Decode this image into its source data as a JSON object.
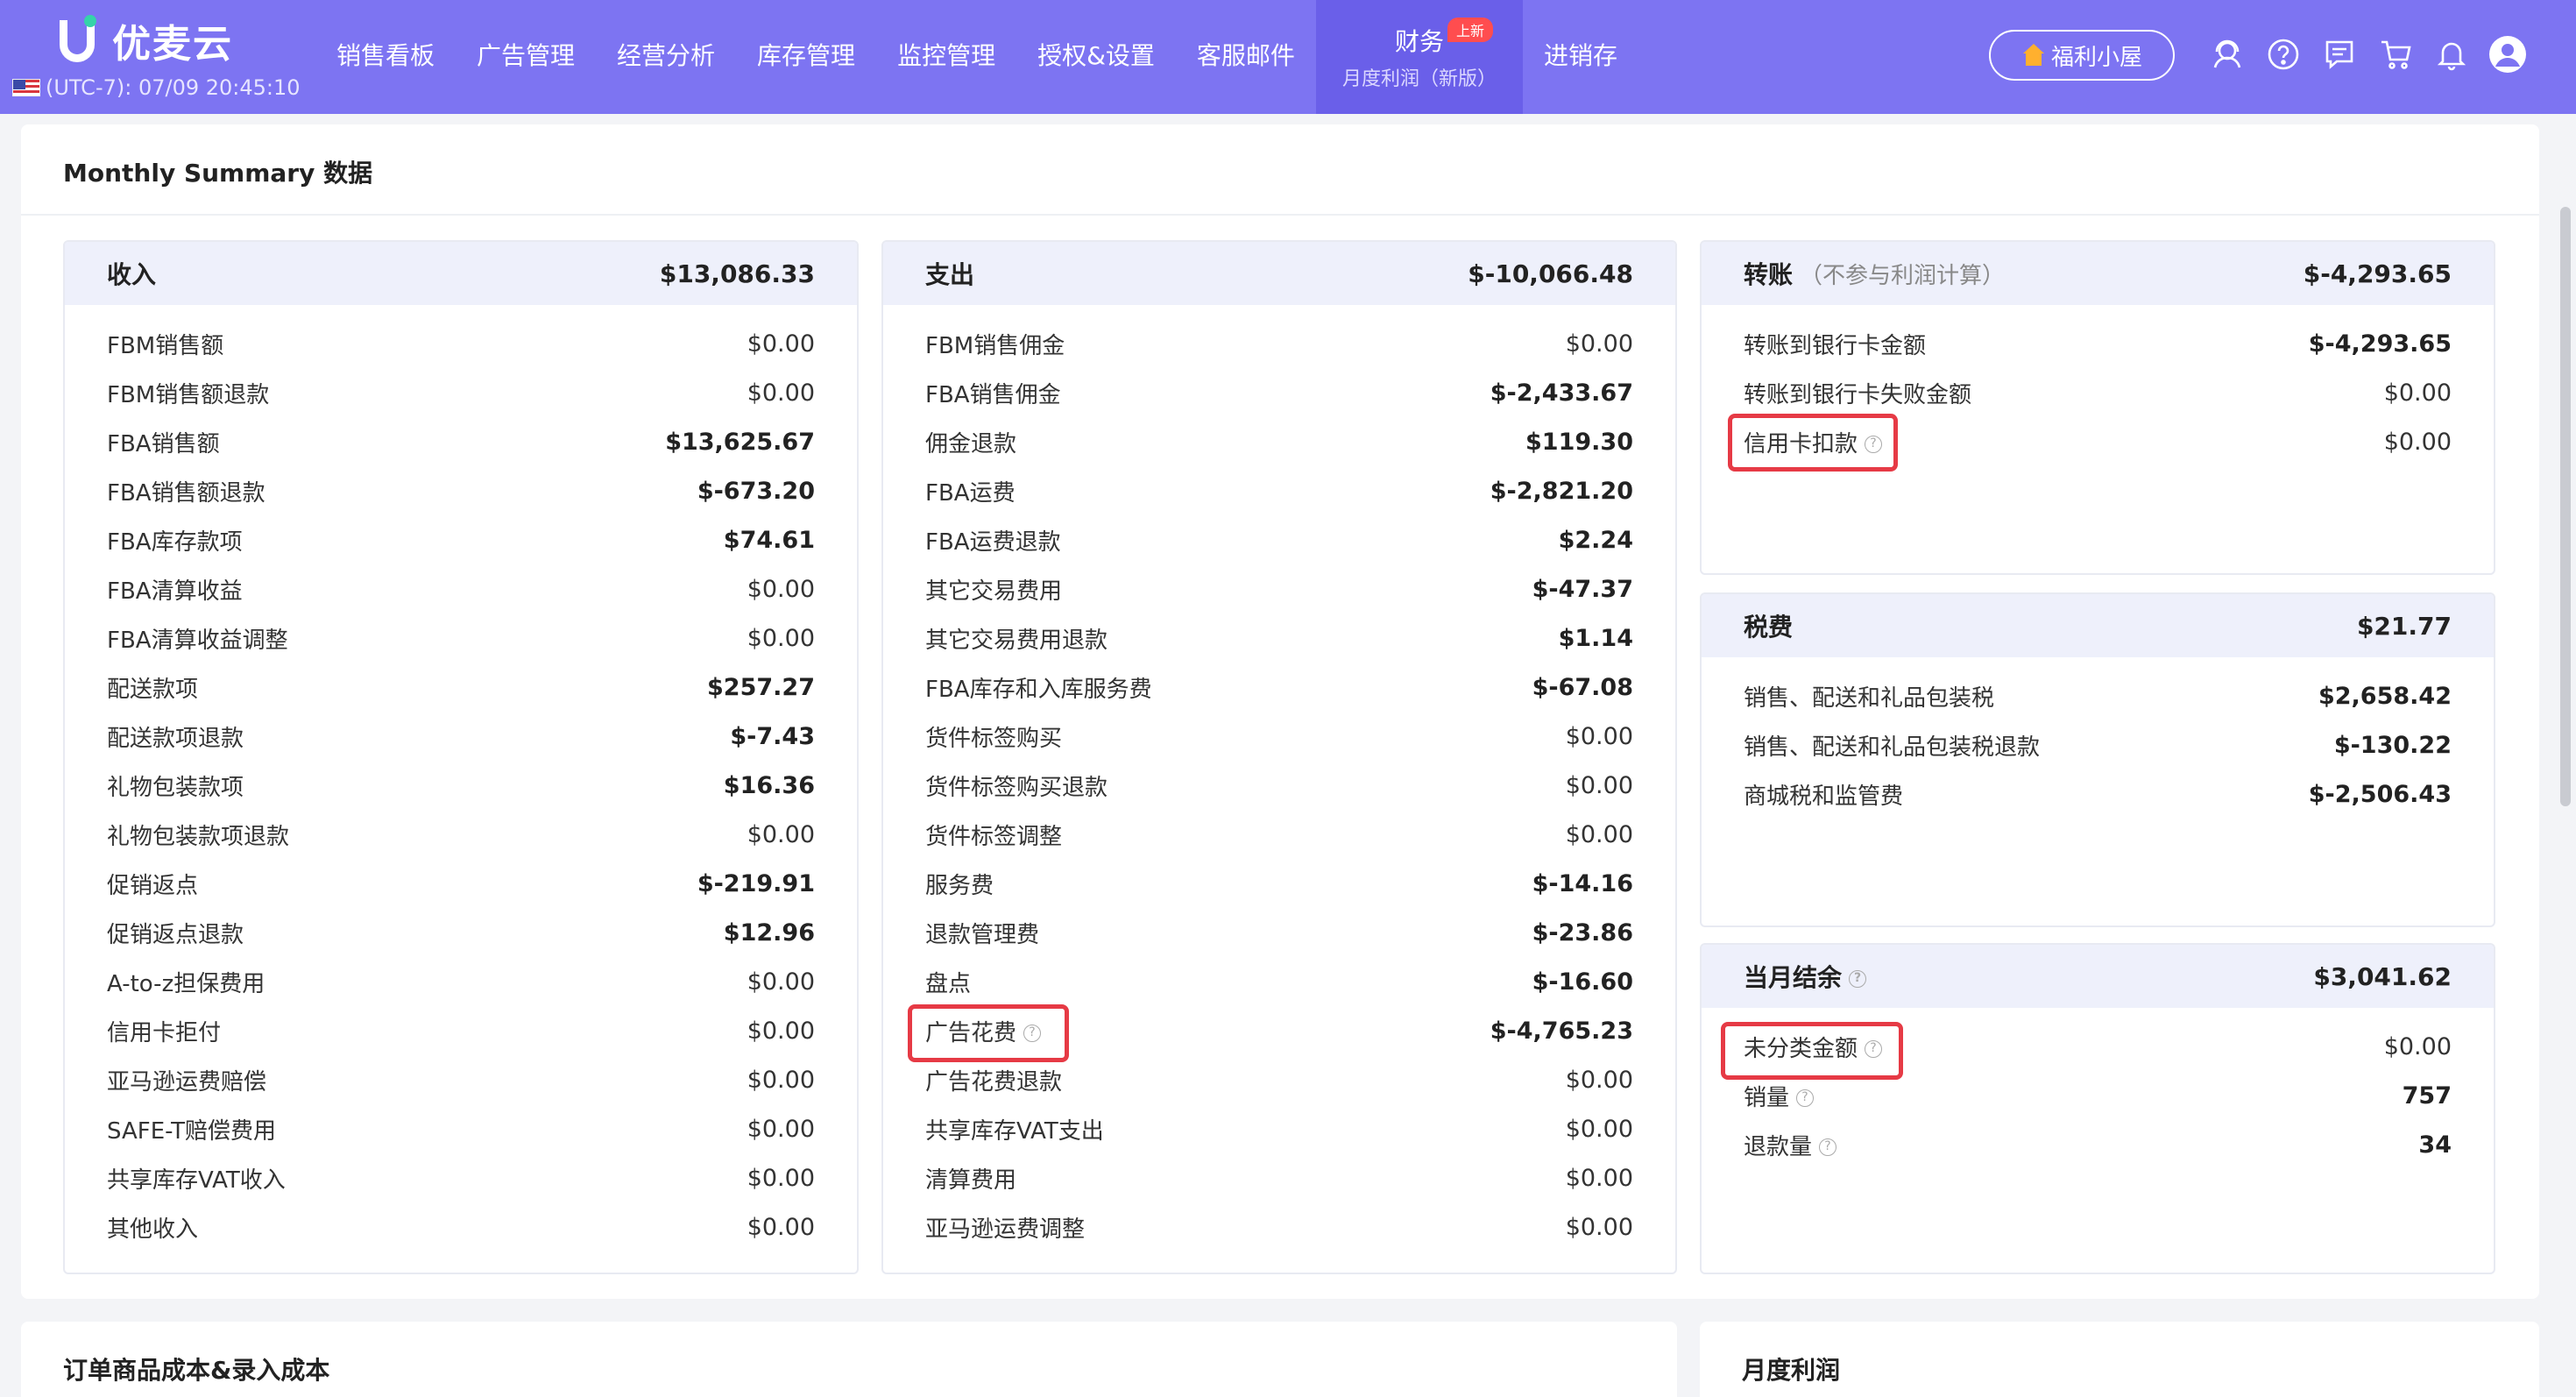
{
  "header": {
    "logo": "优麦云",
    "clock": "(UTC-7): 07/09 20:45:10",
    "nav": [
      {
        "label": "销售看板"
      },
      {
        "label": "广告管理"
      },
      {
        "label": "经营分析"
      },
      {
        "label": "库存管理"
      },
      {
        "label": "监控管理"
      },
      {
        "label": "授权&设置"
      },
      {
        "label": "客服邮件"
      },
      {
        "label": "财务",
        "sub": "月度利润（新版）",
        "badge": "上新",
        "active": true
      },
      {
        "label": "进销存"
      }
    ],
    "welfare_label": "福利小屋",
    "icons": [
      "support-icon",
      "help-icon",
      "message-icon",
      "cart-icon",
      "bell-icon",
      "user-avatar-icon"
    ]
  },
  "summary": {
    "title": "Monthly Summary 数据",
    "income": {
      "title": "收入",
      "total": "$13,086.33",
      "rows": [
        {
          "label": "FBM销售额",
          "value": "$0.00"
        },
        {
          "label": "FBM销售额退款",
          "value": "$0.00"
        },
        {
          "label": "FBA销售额",
          "value": "$13,625.67"
        },
        {
          "label": "FBA销售额退款",
          "value": "$-673.20"
        },
        {
          "label": "FBA库存款项",
          "value": "$74.61"
        },
        {
          "label": "FBA清算收益",
          "value": "$0.00"
        },
        {
          "label": "FBA清算收益调整",
          "value": "$0.00"
        },
        {
          "label": "配送款项",
          "value": "$257.27"
        },
        {
          "label": "配送款项退款",
          "value": "$-7.43"
        },
        {
          "label": "礼物包装款项",
          "value": "$16.36"
        },
        {
          "label": "礼物包装款项退款",
          "value": "$0.00"
        },
        {
          "label": "促销返点",
          "value": "$-219.91"
        },
        {
          "label": "促销返点退款",
          "value": "$12.96"
        },
        {
          "label": "A-to-z担保费用",
          "value": "$0.00"
        },
        {
          "label": "信用卡拒付",
          "value": "$0.00"
        },
        {
          "label": "亚马逊运费赔偿",
          "value": "$0.00"
        },
        {
          "label": "SAFE-T赔偿费用",
          "value": "$0.00"
        },
        {
          "label": "共享库存VAT收入",
          "value": "$0.00"
        },
        {
          "label": "其他收入",
          "value": "$0.00"
        }
      ]
    },
    "expense": {
      "title": "支出",
      "total": "$-10,066.48",
      "rows": [
        {
          "label": "FBM销售佣金",
          "value": "$0.00"
        },
        {
          "label": "FBA销售佣金",
          "value": "$-2,433.67"
        },
        {
          "label": "佣金退款",
          "value": "$119.30"
        },
        {
          "label": "FBA运费",
          "value": "$-2,821.20"
        },
        {
          "label": "FBA运费退款",
          "value": "$2.24"
        },
        {
          "label": "其它交易费用",
          "value": "$-47.37"
        },
        {
          "label": "其它交易费用退款",
          "value": "$1.14"
        },
        {
          "label": "FBA库存和入库服务费",
          "value": "$-67.08"
        },
        {
          "label": "货件标签购买",
          "value": "$0.00"
        },
        {
          "label": "货件标签购买退款",
          "value": "$0.00"
        },
        {
          "label": "货件标签调整",
          "value": "$0.00"
        },
        {
          "label": "服务费",
          "value": "$-14.16"
        },
        {
          "label": "退款管理费",
          "value": "$-23.86"
        },
        {
          "label": "盘点",
          "value": "$-16.60"
        },
        {
          "label": "广告花费",
          "value": "$-4,765.23",
          "help": true
        },
        {
          "label": "广告花费退款",
          "value": "$0.00"
        },
        {
          "label": "共享库存VAT支出",
          "value": "$0.00"
        },
        {
          "label": "清算费用",
          "value": "$0.00"
        },
        {
          "label": "亚马逊运费调整",
          "value": "$0.00"
        }
      ]
    },
    "transfer": {
      "title": "转账",
      "note": "（不参与利润计算）",
      "total": "$-4,293.65",
      "rows": [
        {
          "label": "转账到银行卡金额",
          "value": "$-4,293.65"
        },
        {
          "label": "转账到银行卡失败金额",
          "value": "$0.00"
        },
        {
          "label": "信用卡扣款",
          "value": "$0.00",
          "help": true
        }
      ]
    },
    "tax": {
      "title": "税费",
      "total": "$21.77",
      "rows": [
        {
          "label": "销售、配送和礼品包装税",
          "value": "$2,658.42"
        },
        {
          "label": "销售、配送和礼品包装税退款",
          "value": "$-130.22"
        },
        {
          "label": "商城税和监管费",
          "value": "$-2,506.43"
        }
      ]
    },
    "balance": {
      "title": "当月结余",
      "total": "$3,041.62",
      "rows": [
        {
          "label": "未分类金额",
          "value": "$0.00",
          "help": true
        },
        {
          "label": "销量",
          "value": "757",
          "help": true
        },
        {
          "label": "退款量",
          "value": "34",
          "help": true
        }
      ]
    }
  },
  "bottom": {
    "order_cost_title": "订单商品成本&录入成本",
    "monthly_profit_title": "月度利润"
  },
  "colors": {
    "nav_bg": "#7d74f2",
    "nav_active": "#6a5fe9",
    "panel_head": "#eef0fb",
    "highlight": "#e63a45",
    "badge": "#ff4d4f"
  }
}
